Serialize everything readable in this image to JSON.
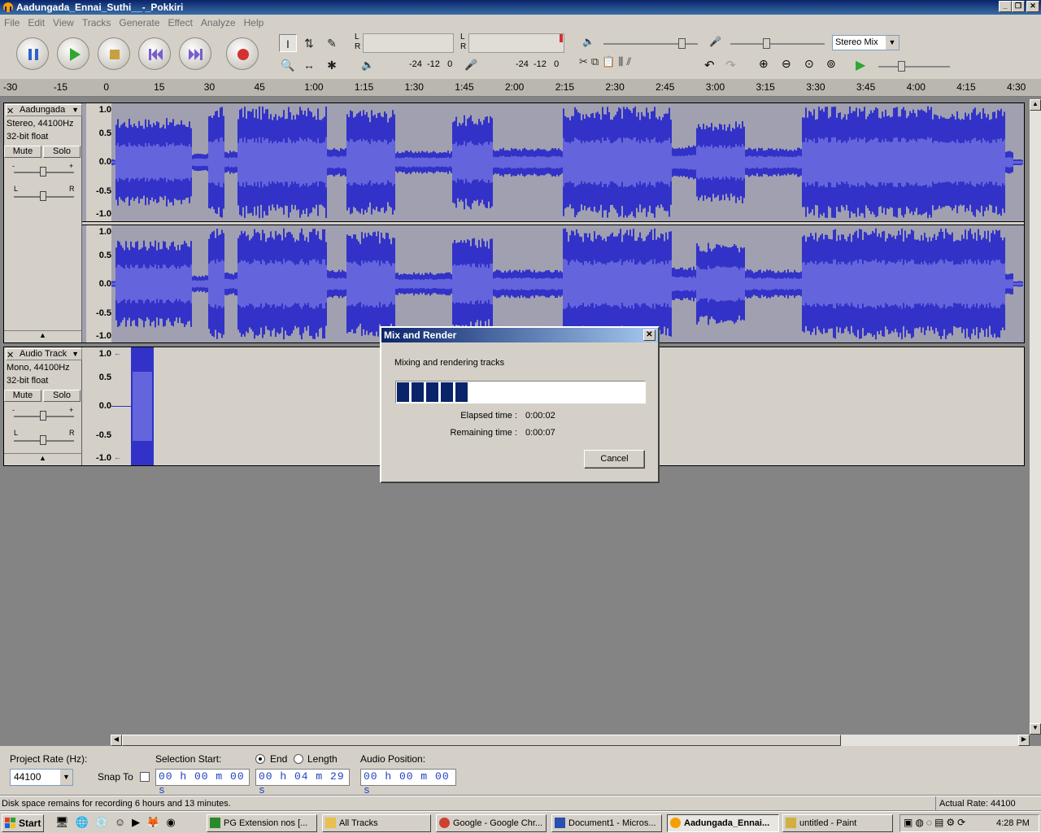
{
  "window": {
    "title": "Aadungada_Ennai_Suthi__-_Pokkiri",
    "minimize": "_",
    "restore": "❐",
    "close": "✕"
  },
  "menu": [
    "File",
    "Edit",
    "View",
    "Tracks",
    "Generate",
    "Effect",
    "Analyze",
    "Help"
  ],
  "transport": {
    "pause": "pause-icon",
    "play": "play-icon",
    "stop": "stop-icon",
    "skip_start": "skip-start-icon",
    "skip_end": "skip-end-icon",
    "record": "record-icon"
  },
  "tools": {
    "select": "I",
    "envelope": "⇅",
    "draw": "✎",
    "zoom": "🔍",
    "timeshift": "↔",
    "multi": "✱"
  },
  "meters": {
    "play_label_l": "L",
    "play_label_r": "R",
    "rec_label_l": "L",
    "rec_label_r": "R",
    "play_scale": "-24  -12   0",
    "rec_scale": "-24  -12   0"
  },
  "mixer": {
    "input_source": "Stereo Mix"
  },
  "ruler": {
    "ticks": [
      "-30",
      "-15",
      "0",
      "15",
      "30",
      "45",
      "1:00",
      "1:15",
      "1:30",
      "1:45",
      "2:00",
      "2:15",
      "2:30",
      "2:45",
      "3:00",
      "3:15",
      "3:30",
      "3:45",
      "4:00",
      "4:15",
      "4:30"
    ]
  },
  "tracks": [
    {
      "name": "Aadungada",
      "info1": "Stereo, 44100Hz",
      "info2": "32-bit float",
      "mute": "Mute",
      "solo": "Solo",
      "scale": [
        "1.0",
        "0.5",
        "0.0",
        "-0.5",
        "-1.0"
      ]
    },
    {
      "name": "Audio Track",
      "info1": "Mono, 44100Hz",
      "info2": "32-bit float",
      "mute": "Mute",
      "solo": "Solo",
      "scale": [
        "1.0",
        "0.5",
        "0.0",
        "-0.5",
        "-1.0"
      ]
    }
  ],
  "gain_labels": {
    "minus": "-",
    "plus": "+",
    "left": "L",
    "right": "R"
  },
  "dialog": {
    "title": "Mix and Render",
    "message": "Mixing and rendering tracks",
    "progress": 0.3,
    "elapsed_label": "Elapsed time :",
    "elapsed": "0:00:02",
    "remaining_label": "Remaining time :",
    "remaining": "0:00:07",
    "cancel": "Cancel"
  },
  "selection": {
    "project_rate_label": "Project Rate (Hz):",
    "project_rate": "44100",
    "snap_to": "Snap To",
    "selection_start_label": "Selection Start:",
    "end_label": "End",
    "length_label": "Length",
    "audio_position_label": "Audio Position:",
    "start_time": "00 h 00 m 00 s",
    "end_time": "00 h 04 m 29 s",
    "position": "00 h 00 m 00 s"
  },
  "status": {
    "disk": "Disk space remains for recording 6 hours and 13 minutes.",
    "rate": "Actual Rate: 44100"
  },
  "taskbar": {
    "start": "Start",
    "tasks": [
      "PG Extension nos  [...",
      "All Tracks",
      "Google - Google Chr...",
      "Document1 - Micros...",
      "Aadungada_Ennai...",
      "untitled - Paint"
    ],
    "clock": "4:28 PM"
  },
  "colors": {
    "waveform": "#3232c8",
    "waveform_rms": "#6464dc",
    "dialog_title": "#0a246a",
    "progress_block": "#0a246a"
  }
}
